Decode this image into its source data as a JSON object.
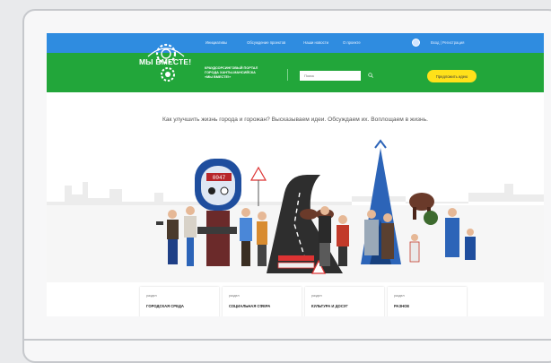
{
  "colors": {
    "topbar": "#2f8ce0",
    "greenbar": "#22a63a",
    "accent": "#ffe11a"
  },
  "nav": {
    "items": [
      "Инициативы",
      "Обсуждение проектов",
      "Наши новости",
      "О проекте"
    ],
    "login_label": "Вход | Регистрация"
  },
  "brand": {
    "logo_text": "МЫ ВМЕСТЕ!",
    "portal_line1": "КРАУДСОРСИНГОВЫЙ ПОРТАЛ",
    "portal_line2": "ГОРОДА ХАНТЫ-МАНСИЙСКА",
    "portal_line3": "«МЫ ВМЕСТЕ!»"
  },
  "search": {
    "placeholder": "Поиск",
    "icon": "magnifier"
  },
  "idea_button": {
    "label": "Предложить идею"
  },
  "hero": {
    "tagline": "Как улучшить жизнь города и горожан? Высказываем идеи. Обсуждаем их. Воплощаем в жизнь.",
    "meter_reading": "0047"
  },
  "cards": [
    {
      "label": "раздел",
      "title": "ГОРОДСКАЯ СРЕДА"
    },
    {
      "label": "раздел",
      "title": "СОЦИАЛЬНАЯ СФЕРА"
    },
    {
      "label": "раздел",
      "title": "КУЛЬТУРА И ДОСУГ"
    },
    {
      "label": "раздел",
      "title": "РАЗНОЕ"
    }
  ]
}
